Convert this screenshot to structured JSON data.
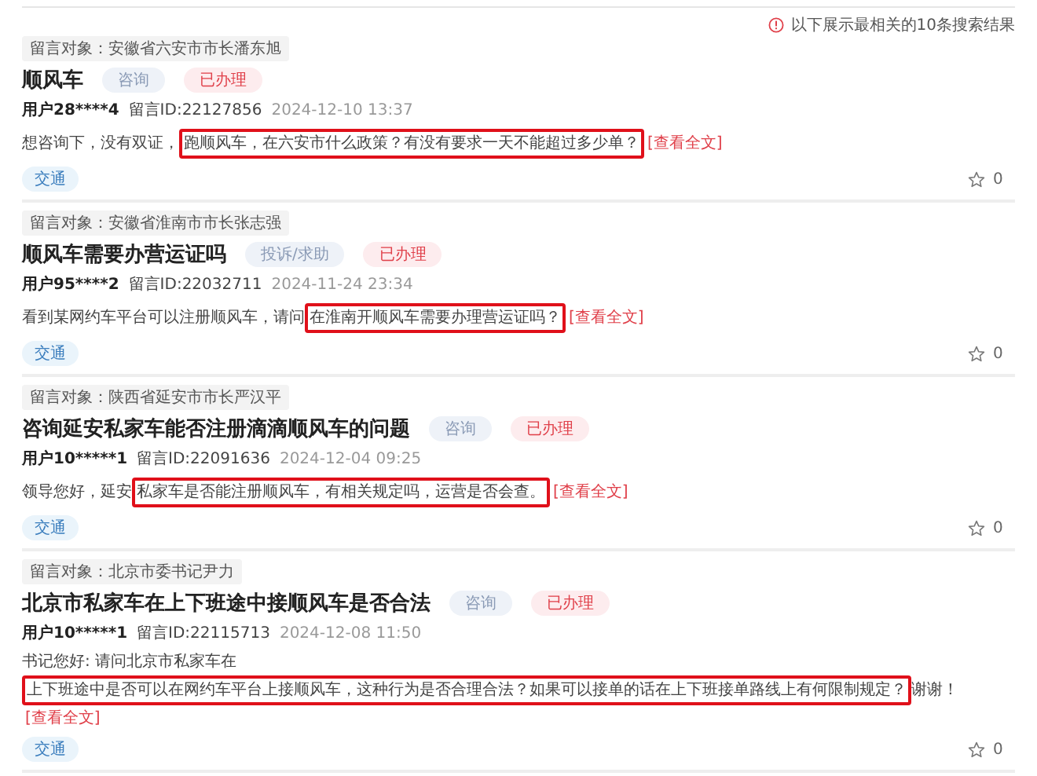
{
  "notice": "以下展示最相关的10条搜索结果",
  "messages": [
    {
      "target": "留言对象：安徽省六安市市长潘东旭",
      "title": "**顺风车**",
      "tags": [
        {
          "label": "咨询",
          "kind": "type"
        },
        {
          "label": "已办理",
          "kind": "status"
        }
      ],
      "user": "用户28****4",
      "message_id": "留言ID:22127856",
      "time": "2024-12-10 13:37",
      "body_before": "想咨询下，没有双证，",
      "body_highlight": "跑顺风车，在六安市什么政策？有没有要求一天不能超过多少单？",
      "link": "[查看全文]",
      "category": "交通",
      "likes": "0"
    },
    {
      "target": "留言对象：安徽省淮南市市长张志强",
      "title": "**顺风车**需要办营运证吗",
      "tags": [
        {
          "label": "投诉/求助",
          "kind": "type"
        },
        {
          "label": "已办理",
          "kind": "status"
        }
      ],
      "user": "用户95****2",
      "message_id": "留言ID:22032711",
      "time": "2024-11-24 23:34",
      "body_before": "看到某网约车平台可以注册顺风车，请问",
      "body_highlight": "在淮南开顺风车需要办理营运证吗？",
      "link": "[查看全文]",
      "category": "交通",
      "likes": "0"
    },
    {
      "target": "留言对象：陕西省延安市市长严汉平",
      "title": "咨询延安私家车能否注册滴滴**顺风车**的问题",
      "tags": [
        {
          "label": "咨询",
          "kind": "type"
        },
        {
          "label": "已办理",
          "kind": "status"
        }
      ],
      "user": "用户10*****1",
      "message_id": "留言ID:22091636",
      "time": "2024-12-04 09:25",
      "body_before": "领导您好，延安",
      "body_highlight": "私家车是否能注册顺风车，有相关规定吗，运营是否会查。",
      "link": "[查看全文]",
      "category": "交通",
      "likes": "0"
    },
    {
      "target": "留言对象：北京市委书记尹力",
      "title": "北京市私家车在上下班途中接**顺风车**是否合法",
      "tags": [
        {
          "label": "咨询",
          "kind": "type"
        },
        {
          "label": "已办理",
          "kind": "status"
        }
      ],
      "user": "用户10*****1",
      "message_id": "留言ID:22115713",
      "time": "2024-12-08 11:50",
      "body_before": "书记您好: 请问北京市私家车在",
      "body_highlight": "上下班途中是否可以在网约车平台上接顺风车，这种行为是否合理合法？如果可以接单的话在上下班接单路线上有何限制规定？",
      "body_after": "谢谢！",
      "link": "[查看全文]",
      "category": "交通",
      "likes": "0"
    }
  ]
}
